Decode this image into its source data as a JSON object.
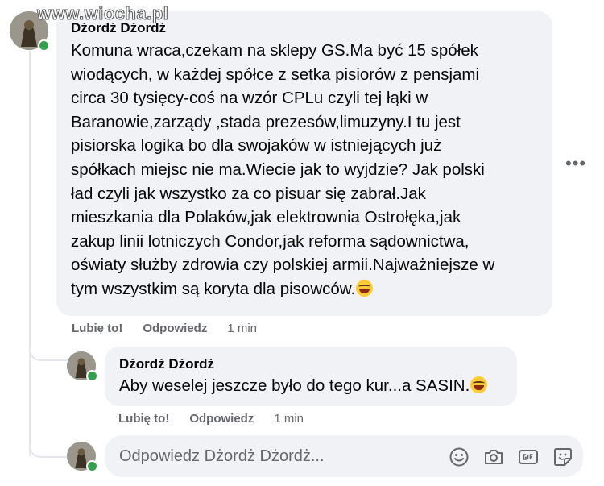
{
  "watermark": "www.wiocha.pl",
  "comment": {
    "author": "Dżordż Dżordż",
    "text": "Komuna wraca,czekam na sklepy GS.Ma być 15 spółek\nwiodących, w każdej spółce z setka pisiorów z pensjami\ncirca 30 tysięcy-coś na wzór CPLu czyli tej łąki w\nBaranowie,zarządy ,stada prezesów,limuzyny.I tu jest\npisiorska logika bo dla swojaków w istniejących już\nspółkach miejsc nie ma.Wiecie jak to wyjdzie? Jak polski\nład czyli jak wszystko za co pisuar się zabrał.Jak\nmieszkania dla Polaków,jak elektrownia Ostrołęka,jak\nzakup linii lotniczych Condor,jak reforma sądownictwa,\noświaty służby zdrowia czy polskiej armii.Najważniejsze w\ntym wszystkim są koryta dla pisowców.",
    "emoji": "rolling-on-floor-laughing",
    "like_label": "Lubię to!",
    "reply_label": "Odpowiedz",
    "time": "1 min",
    "more_label": "•••"
  },
  "reply": {
    "author": "Dżordż Dżordż",
    "text": "Aby weselej jeszcze było do tego kur...a SASIN.",
    "emoji": "rolling-on-floor-laughing",
    "like_label": "Lubię to!",
    "reply_label": "Odpowiedz",
    "time": "1 min"
  },
  "composer": {
    "placeholder": "Odpowiedz Dżordż Dżordż...",
    "icons": [
      "emoji-icon",
      "camera-icon",
      "gif-icon",
      "sticker-icon"
    ]
  },
  "colors": {
    "bubble": "#f0f2f5",
    "online": "#31a24c",
    "secondary_text": "#65676b"
  }
}
